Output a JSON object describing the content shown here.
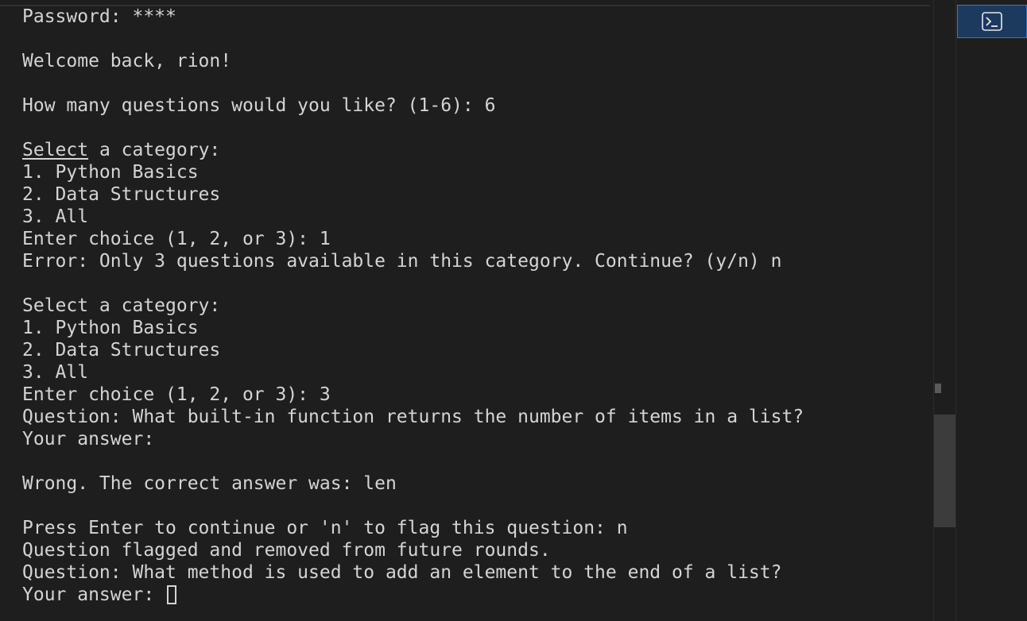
{
  "terminal": {
    "lines": [
      {
        "text": "Password: ****"
      },
      {
        "text": ""
      },
      {
        "text": "Welcome back, rion!"
      },
      {
        "text": ""
      },
      {
        "text": "How many questions would you like? (1-6): 6"
      },
      {
        "text": ""
      },
      {
        "underlined": "Select",
        "text": " a category:"
      },
      {
        "text": "1. Python Basics"
      },
      {
        "text": "2. Data Structures"
      },
      {
        "text": "3. All"
      },
      {
        "text": "Enter choice (1, 2, or 3): 1"
      },
      {
        "text": "Error: Only 3 questions available in this category. Continue? (y/n) n"
      },
      {
        "text": ""
      },
      {
        "text": "Select a category:"
      },
      {
        "text": "1. Python Basics"
      },
      {
        "text": "2. Data Structures"
      },
      {
        "text": "3. All"
      },
      {
        "text": "Enter choice (1, 2, or 3): 3"
      },
      {
        "text": "Question: What built-in function returns the number of items in a list?"
      },
      {
        "text": "Your answer:"
      },
      {
        "text": ""
      },
      {
        "text": "Wrong. The correct answer was: len"
      },
      {
        "text": ""
      },
      {
        "text": "Press Enter to continue or 'n' to flag this question: n"
      },
      {
        "text": "Question flagged and removed from future rounds."
      },
      {
        "text": "Question: What method is used to add an element to the end of a list?"
      },
      {
        "text": "Your answer: ",
        "cursor": true
      }
    ]
  },
  "side_panel": {
    "tab_icon": "terminal-icon"
  },
  "colors": {
    "background": "#1e1e1e",
    "text": "#d4d4d4",
    "tab_active": "#1c3a5e",
    "tab_border": "#3a78c4"
  }
}
